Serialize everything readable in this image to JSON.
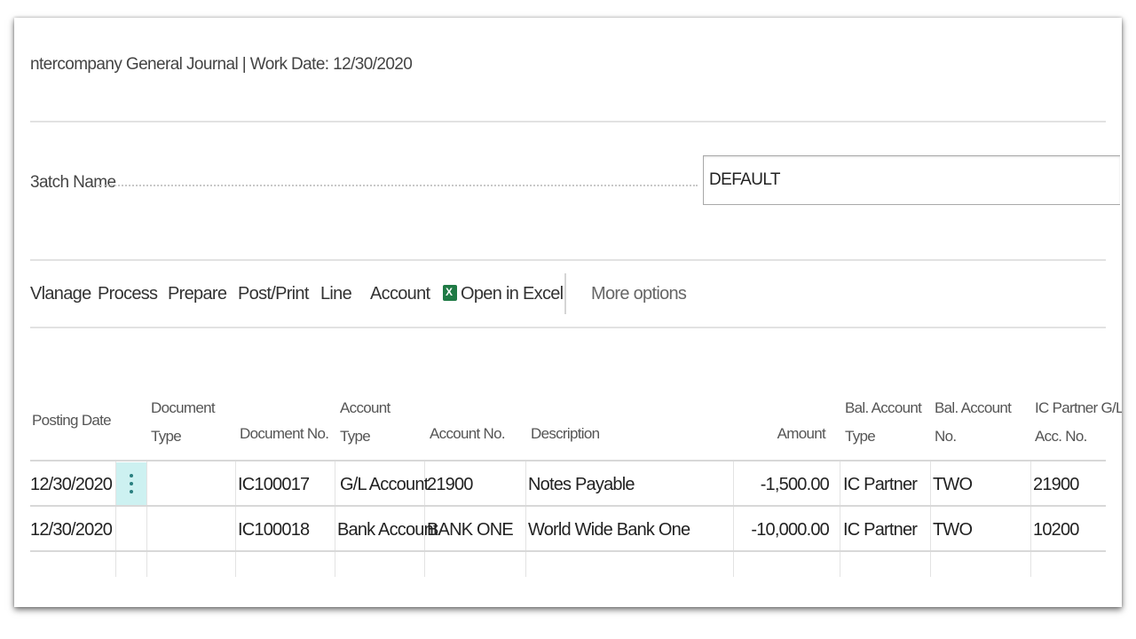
{
  "page": {
    "title": "ntercompany General Journal | Work Date: 12/30/2020"
  },
  "batch": {
    "label": "3atch Name",
    "value": "DEFAULT"
  },
  "actions": [
    {
      "label": "Vlanage"
    },
    {
      "label": "Process"
    },
    {
      "label": "Prepare"
    },
    {
      "label": "Post/Print"
    },
    {
      "label": "Line"
    },
    {
      "label": "Account"
    },
    {
      "label": "Open in Excel",
      "icon": "excel-icon"
    },
    {
      "label": "More options"
    }
  ],
  "columns": [
    {
      "line1": "",
      "line2": "Posting Date"
    },
    {
      "line1": "Document",
      "line2": "Type"
    },
    {
      "line1": "",
      "line2": "Document No."
    },
    {
      "line1": "Account",
      "line2": "Type"
    },
    {
      "line1": "",
      "line2": "Account No."
    },
    {
      "line1": "",
      "line2": "Description"
    },
    {
      "line1": "",
      "line2": "Amount"
    },
    {
      "line1": "Bal. Account",
      "line2": "Type"
    },
    {
      "line1": "Bal. Account",
      "line2": "No."
    },
    {
      "line1": "IC Partner G/L",
      "line2": "Acc. No."
    }
  ],
  "rows": [
    {
      "posting_date": "12/30/2020",
      "document_type": "",
      "document_no": "IC100017",
      "account_type": "G/L Account",
      "account_no": "21900",
      "description": "Notes Payable",
      "amount": "-1,500.00",
      "bal_account_type": "IC Partner",
      "bal_account_no": "TWO",
      "ic_partner_acc_no": "21900"
    },
    {
      "posting_date": "12/30/2020",
      "document_type": "",
      "document_no": "IC100018",
      "account_type": "Bank Account",
      "account_no": "BANK ONE",
      "description": "World Wide Bank One",
      "amount": "-10,000.00",
      "bal_account_type": "IC Partner",
      "bal_account_no": "TWO",
      "ic_partner_acc_no": "10200"
    }
  ],
  "colors": {
    "row_menu_highlight": "#cdf1f1",
    "excel_green": "#1f7a45"
  }
}
